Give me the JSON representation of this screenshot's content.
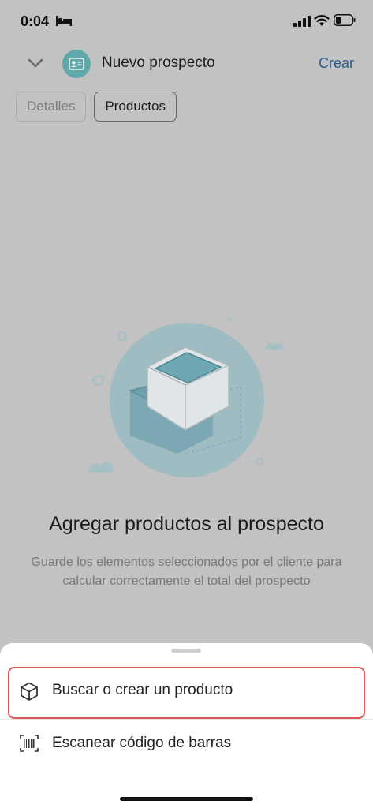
{
  "status_bar": {
    "time": "0:04",
    "icons": [
      "bed-icon",
      "signal-icon",
      "wifi-icon",
      "battery-icon"
    ]
  },
  "header": {
    "title": "Nuevo prospecto",
    "create_label": "Crear",
    "icons": [
      "chevron-down-icon",
      "contact-card-icon"
    ]
  },
  "tabs": [
    {
      "label": "Detalles",
      "active": false
    },
    {
      "label": "Productos",
      "active": true
    }
  ],
  "empty_state": {
    "title": "Agregar productos al prospecto",
    "description": "Guarde los elementos seleccionados por el cliente para calcular correctamente el total del prospecto",
    "illustration": "product-box-illustration"
  },
  "sheet": {
    "items": [
      {
        "label": "Buscar o crear un producto",
        "icon": "cube-icon"
      },
      {
        "label": "Escanear código de barras",
        "icon": "barcode-scan-icon"
      }
    ]
  },
  "colors": {
    "overlay_background": "#c2c2c2",
    "accent_link": "#2c5c8a",
    "avatar": "#5fa9ab",
    "highlight": "#e05a5a"
  }
}
